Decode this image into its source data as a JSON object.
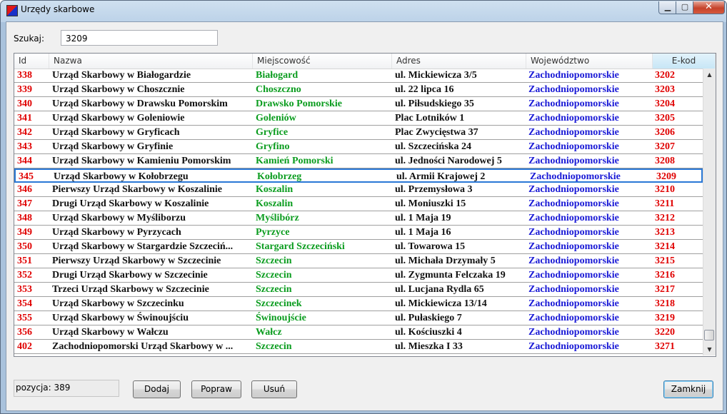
{
  "window": {
    "title": "Urzędy skarbowe"
  },
  "search": {
    "label": "Szukaj:",
    "value": "3209"
  },
  "table": {
    "columns": [
      "Id",
      "Nazwa",
      "Miejscowość",
      "Adres",
      "Województwo",
      "E-kod"
    ],
    "selected_index": 7,
    "rows": [
      {
        "id": "338",
        "nazwa": "Urząd Skarbowy w Białogardzie",
        "miejscowosc": "Białogard",
        "adres": "ul. Mickiewicza 3/5",
        "wojewodztwo": "Zachodniopomorskie",
        "ekod": "3202"
      },
      {
        "id": "339",
        "nazwa": "Urząd Skarbowy w Choszcznie",
        "miejscowosc": "Choszczno",
        "adres": "ul. 22 lipca 16",
        "wojewodztwo": "Zachodniopomorskie",
        "ekod": "3203"
      },
      {
        "id": "340",
        "nazwa": "Urząd Skarbowy w Drawsku Pomorskim",
        "miejscowosc": "Drawsko Pomorskie",
        "adres": "ul. Piłsudskiego 35",
        "wojewodztwo": "Zachodniopomorskie",
        "ekod": "3204"
      },
      {
        "id": "341",
        "nazwa": "Urząd Skarbowy w Goleniowie",
        "miejscowosc": "Goleniów",
        "adres": "Plac Lotników 1",
        "wojewodztwo": "Zachodniopomorskie",
        "ekod": "3205"
      },
      {
        "id": "342",
        "nazwa": "Urząd Skarbowy w Gryficach",
        "miejscowosc": "Gryfice",
        "adres": "Plac Zwycięstwa 37",
        "wojewodztwo": "Zachodniopomorskie",
        "ekod": "3206"
      },
      {
        "id": "343",
        "nazwa": "Urząd Skarbowy w Gryfinie",
        "miejscowosc": "Gryfino",
        "adres": "ul. Szczecińska 24",
        "wojewodztwo": "Zachodniopomorskie",
        "ekod": "3207"
      },
      {
        "id": "344",
        "nazwa": "Urząd Skarbowy w Kamieniu Pomorskim",
        "miejscowosc": "Kamień Pomorski",
        "adres": "ul. Jedności Narodowej 5",
        "wojewodztwo": "Zachodniopomorskie",
        "ekod": "3208"
      },
      {
        "id": "345",
        "nazwa": "Urząd Skarbowy w Kołobrzegu",
        "miejscowosc": "Kołobrzeg",
        "adres": "ul. Armii Krajowej 2",
        "wojewodztwo": "Zachodniopomorskie",
        "ekod": "3209"
      },
      {
        "id": "346",
        "nazwa": "Pierwszy Urząd Skarbowy w Koszalinie",
        "miejscowosc": "Koszalin",
        "adres": "ul. Przemysłowa 3",
        "wojewodztwo": "Zachodniopomorskie",
        "ekod": "3210"
      },
      {
        "id": "347",
        "nazwa": "Drugi Urząd Skarbowy w Koszalinie",
        "miejscowosc": "Koszalin",
        "adres": "ul. Moniuszki 15",
        "wojewodztwo": "Zachodniopomorskie",
        "ekod": "3211"
      },
      {
        "id": "348",
        "nazwa": "Urząd Skarbowy w Myśliborzu",
        "miejscowosc": "Myślibórz",
        "adres": "ul. 1 Maja 19",
        "wojewodztwo": "Zachodniopomorskie",
        "ekod": "3212"
      },
      {
        "id": "349",
        "nazwa": "Urząd Skarbowy w Pyrzycach",
        "miejscowosc": "Pyrzyce",
        "adres": "ul. 1 Maja 16",
        "wojewodztwo": "Zachodniopomorskie",
        "ekod": "3213"
      },
      {
        "id": "350",
        "nazwa": "Urząd Skarbowy w Stargardzie Szczeciń...",
        "miejscowosc": "Stargard Szczeciński",
        "adres": "ul. Towarowa 15",
        "wojewodztwo": "Zachodniopomorskie",
        "ekod": "3214"
      },
      {
        "id": "351",
        "nazwa": "Pierwszy Urząd Skarbowy w Szczecinie",
        "miejscowosc": "Szczecin",
        "adres": "ul. Michała Drzymały 5",
        "wojewodztwo": "Zachodniopomorskie",
        "ekod": "3215"
      },
      {
        "id": "352",
        "nazwa": "Drugi Urząd Skarbowy w Szczecinie",
        "miejscowosc": "Szczecin",
        "adres": "ul. Zygmunta Felczaka 19",
        "wojewodztwo": "Zachodniopomorskie",
        "ekod": "3216"
      },
      {
        "id": "353",
        "nazwa": "Trzeci Urząd Skarbowy w Szczecinie",
        "miejscowosc": "Szczecin",
        "adres": "ul. Lucjana Rydla 65",
        "wojewodztwo": "Zachodniopomorskie",
        "ekod": "3217"
      },
      {
        "id": "354",
        "nazwa": "Urząd Skarbowy w Szczecinku",
        "miejscowosc": "Szczecinek",
        "adres": "ul. Mickiewicza 13/14",
        "wojewodztwo": "Zachodniopomorskie",
        "ekod": "3218"
      },
      {
        "id": "355",
        "nazwa": "Urząd Skarbowy w Świnoujściu",
        "miejscowosc": "Świnoujście",
        "adres": "ul. Pułaskiego 7",
        "wojewodztwo": "Zachodniopomorskie",
        "ekod": "3219"
      },
      {
        "id": "356",
        "nazwa": "Urząd Skarbowy w Wałczu",
        "miejscowosc": "Wałcz",
        "adres": "ul. Kościuszki 4",
        "wojewodztwo": "Zachodniopomorskie",
        "ekod": "3220"
      },
      {
        "id": "402",
        "nazwa": "Zachodniopomorski Urząd Skarbowy w ...",
        "miejscowosc": "Szczecin",
        "adres": "ul. Mieszka I 33",
        "wojewodztwo": "Zachodniopomorskie",
        "ekod": "3271"
      }
    ]
  },
  "status": {
    "position_text": "pozycja:  389"
  },
  "buttons": {
    "add": "Dodaj",
    "edit": "Popraw",
    "delete": "Usuń",
    "close": "Zamknij"
  },
  "icons": {
    "app": "app-icon",
    "minimize": "minimize-icon",
    "maximize": "maximize-icon",
    "close": "close-icon",
    "scroll_up": "scroll-up-arrow-icon",
    "scroll_down": "scroll-down-arrow-icon"
  },
  "colors": {
    "id": "#e00000",
    "nazwa": "#111111",
    "miejscowosc": "#0a9c1e",
    "adres": "#111111",
    "wojewodztwo": "#1a1ad6",
    "ekod": "#e00000",
    "selection_border": "#2a78d6"
  }
}
